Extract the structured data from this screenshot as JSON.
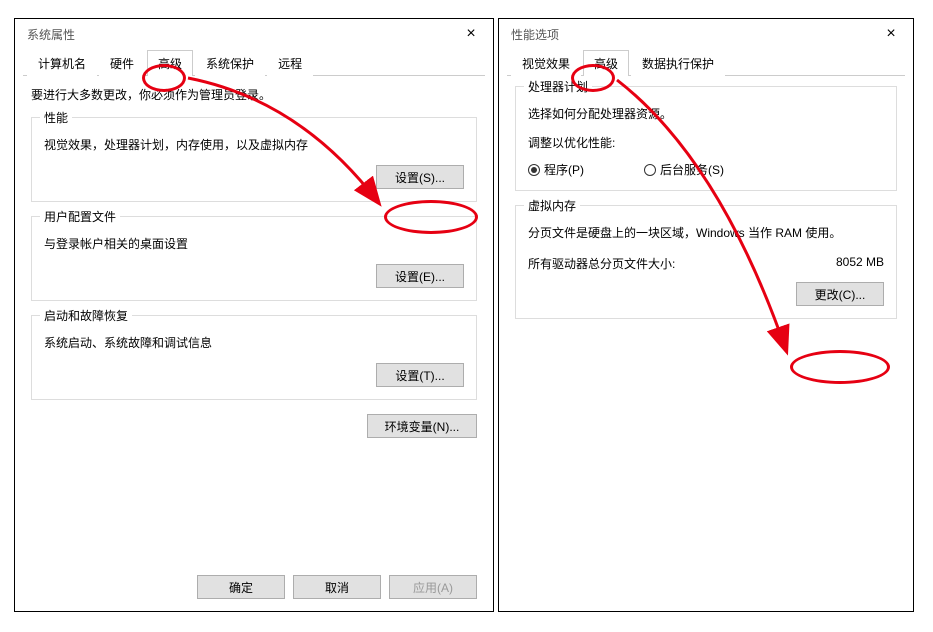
{
  "left_window": {
    "title": "系统属性",
    "tabs": {
      "computer_name": "计算机名",
      "hardware": "硬件",
      "advanced": "高级",
      "system_protection": "系统保护",
      "remote": "远程"
    },
    "admin_note": "要进行大多数更改，你必须作为管理员登录。",
    "performance": {
      "title": "性能",
      "desc": "视觉效果，处理器计划，内存使用，以及虚拟内存",
      "btn": "设置(S)..."
    },
    "user_profiles": {
      "title": "用户配置文件",
      "desc": "与登录帐户相关的桌面设置",
      "btn": "设置(E)..."
    },
    "startup": {
      "title": "启动和故障恢复",
      "desc": "系统启动、系统故障和调试信息",
      "btn": "设置(T)..."
    },
    "env_btn": "环境变量(N)...",
    "ok": "确定",
    "cancel": "取消",
    "apply": "应用(A)"
  },
  "right_window": {
    "title": "性能选项",
    "tabs": {
      "visual": "视觉效果",
      "advanced": "高级",
      "dep": "数据执行保护"
    },
    "processor": {
      "title": "处理器计划",
      "desc": "选择如何分配处理器资源。",
      "adjust": "调整以优化性能:",
      "programs": "程序(P)",
      "background": "后台服务(S)"
    },
    "virtual_memory": {
      "title": "虚拟内存",
      "desc": "分页文件是硬盘上的一块区域，Windows 当作 RAM 使用。",
      "total_label": "所有驱动器总分页文件大小:",
      "total_value": "8052 MB",
      "btn": "更改(C)..."
    }
  }
}
